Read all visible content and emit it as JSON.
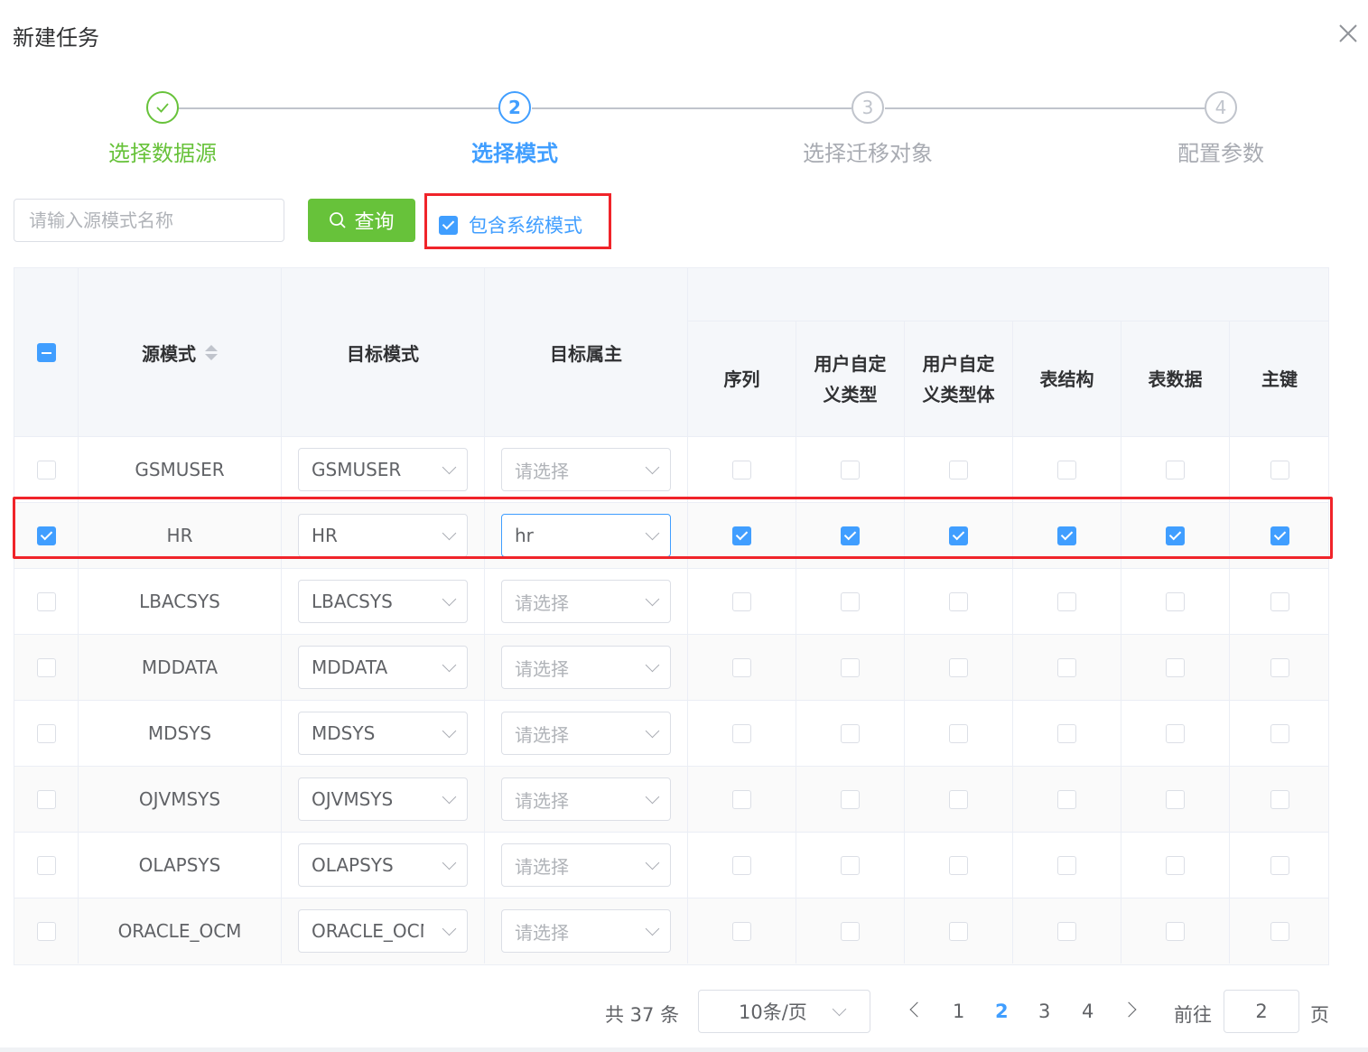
{
  "dialog": {
    "title": "新建任务"
  },
  "steps": [
    {
      "label": "选择数据源",
      "status": "success",
      "number": ""
    },
    {
      "label": "选择模式",
      "status": "process",
      "number": "2"
    },
    {
      "label": "选择迁移对象",
      "status": "wait",
      "number": "3"
    },
    {
      "label": "配置参数",
      "status": "wait",
      "number": "4"
    }
  ],
  "toolbar": {
    "search_placeholder": "请输入源模式名称",
    "query_label": "查询",
    "include_system_label": "包含系统模式",
    "include_system_checked": true
  },
  "table": {
    "headers": {
      "source": "源模式",
      "target_schema": "目标模式",
      "target_owner": "目标属主",
      "sequence": "序列",
      "udt": "用户自定义类型",
      "udt_body": "用户自定义类型体",
      "table_struct": "表结构",
      "table_data": "表数据",
      "primary_key": "主键"
    },
    "select_placeholder": "请选择",
    "rows": [
      {
        "selected": false,
        "source": "GSMUSER",
        "target": "GSMUSER",
        "owner": "",
        "opts": [
          false,
          false,
          false,
          false,
          false,
          false
        ]
      },
      {
        "selected": true,
        "source": "HR",
        "target": "HR",
        "owner": "hr",
        "opts": [
          true,
          true,
          true,
          true,
          true,
          true
        ]
      },
      {
        "selected": false,
        "source": "LBACSYS",
        "target": "LBACSYS",
        "owner": "",
        "opts": [
          false,
          false,
          false,
          false,
          false,
          false
        ]
      },
      {
        "selected": false,
        "source": "MDDATA",
        "target": "MDDATA",
        "owner": "",
        "opts": [
          false,
          false,
          false,
          false,
          false,
          false
        ]
      },
      {
        "selected": false,
        "source": "MDSYS",
        "target": "MDSYS",
        "owner": "",
        "opts": [
          false,
          false,
          false,
          false,
          false,
          false
        ]
      },
      {
        "selected": false,
        "source": "OJVMSYS",
        "target": "OJVMSYS",
        "owner": "",
        "opts": [
          false,
          false,
          false,
          false,
          false,
          false
        ]
      },
      {
        "selected": false,
        "source": "OLAPSYS",
        "target": "OLAPSYS",
        "owner": "",
        "opts": [
          false,
          false,
          false,
          false,
          false,
          false
        ]
      },
      {
        "selected": false,
        "source": "ORACLE_OCM",
        "target": "ORACLE_OCM",
        "owner": "",
        "opts": [
          false,
          false,
          false,
          false,
          false,
          false
        ]
      }
    ]
  },
  "pagination": {
    "total": "共 37 条",
    "page_size": "10条/页",
    "pages": [
      "1",
      "2",
      "3",
      "4"
    ],
    "current": "2",
    "goto_label": "前往",
    "goto_value": "2",
    "page_unit": "页"
  },
  "colors": {
    "primary": "#409eff",
    "success": "#67c23a",
    "highlight": "#f0242a"
  }
}
